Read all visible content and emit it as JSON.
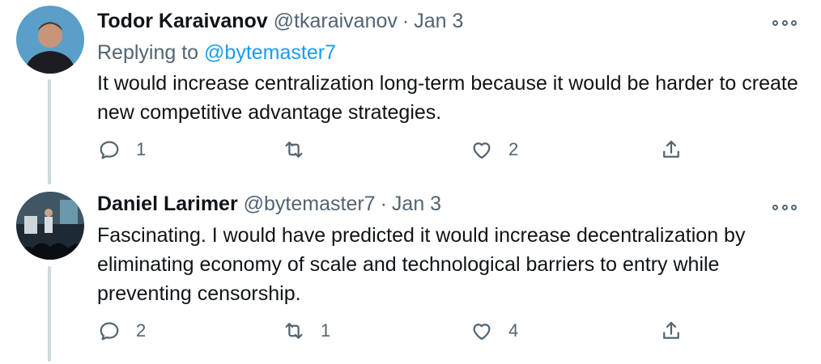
{
  "tweets": [
    {
      "display_name": "Todor Karaivanov",
      "handle": "@tkaraivanov",
      "separator": "·",
      "date": "Jan 3",
      "reply_prefix": "Replying to",
      "reply_mention": "@bytemaster7",
      "text": "It would increase centralization long-term because it would be harder to create new competitive advantage strategies.",
      "reply_count": "1",
      "retweet_count": "",
      "like_count": "2",
      "avatar_icon": "avatar-photo-man-dark-background"
    },
    {
      "display_name": "Daniel Larimer",
      "handle": "@bytemaster7",
      "separator": "·",
      "date": "Jan 3",
      "text": "Fascinating. I would have predicted it would increase decentralization by eliminating economy of scale and technological barriers to entry while preventing censorship.",
      "reply_count": "2",
      "retweet_count": "1",
      "like_count": "4",
      "avatar_icon": "avatar-photo-speaker-on-stage"
    }
  ],
  "icons": [
    "reply-icon",
    "retweet-icon",
    "like-icon",
    "share-icon",
    "more-icon"
  ],
  "colors": {
    "text": "#0f1419",
    "secondary": "#536471",
    "link": "#1d9bf0",
    "thread_line": "#cfd9de"
  }
}
